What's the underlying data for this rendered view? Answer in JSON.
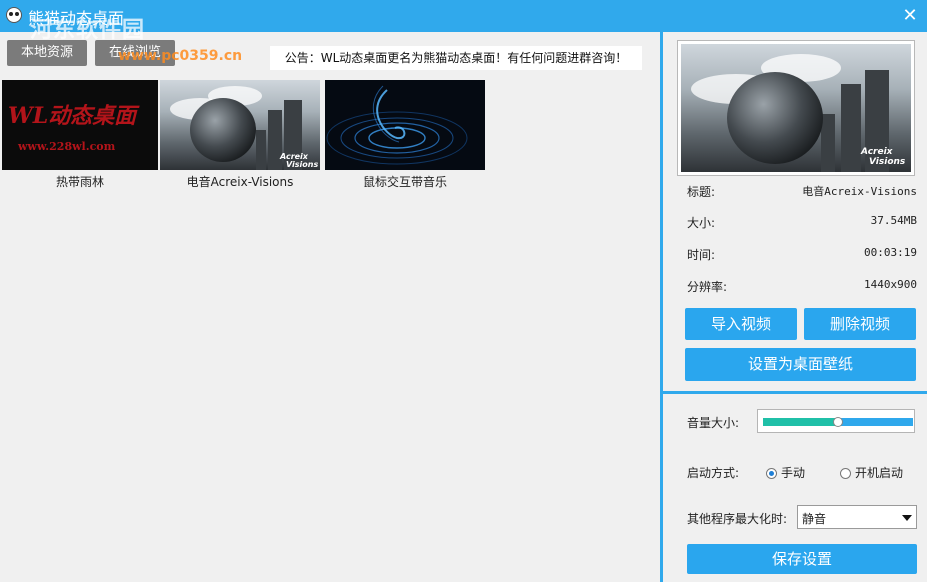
{
  "window": {
    "title": "熊猫动态桌面",
    "watermark": "河东软件园",
    "watermark_url": "www.pc0359.cn"
  },
  "toolbar": {
    "local_tab": "本地资源",
    "online_tab": "在线浏览"
  },
  "notice": "公告：WL动态桌面更名为熊猫动态桌面！有任何问题进群咨询！",
  "videos": [
    {
      "caption": "热带雨林",
      "image_title": "WL动态桌面",
      "image_url": "www.228wl.com"
    },
    {
      "caption": "电音Acreix-Visions",
      "brand_line1": "Acreix",
      "brand_line2": "Visions"
    },
    {
      "caption": "鼠标交互带音乐"
    }
  ],
  "details": {
    "title_label": "标题:",
    "title_value": "电音Acreix-Visions",
    "size_label": "大小:",
    "size_value": "37.54MB",
    "time_label": "时间:",
    "time_value": "00:03:19",
    "resolution_label": "分辨率:",
    "resolution_value": "1440x900",
    "preview_brand_line1": "Acreix",
    "preview_brand_line2": "Visions"
  },
  "actions": {
    "import": "导入视频",
    "delete": "删除视频",
    "set_wallpaper": "设置为桌面壁纸"
  },
  "settings": {
    "volume_label": "音量大小:",
    "volume_level": 0.5,
    "startup_label": "启动方式:",
    "startup_manual": "手动",
    "startup_boot": "开机启动",
    "startup_selected": "manual",
    "maximize_label": "其他程序最大化时:",
    "maximize_value": "静音",
    "save": "保存设置"
  },
  "colors": {
    "accent": "#30a9ec",
    "button": "#2aa6ee",
    "volume_fill": "#20c0a8"
  }
}
